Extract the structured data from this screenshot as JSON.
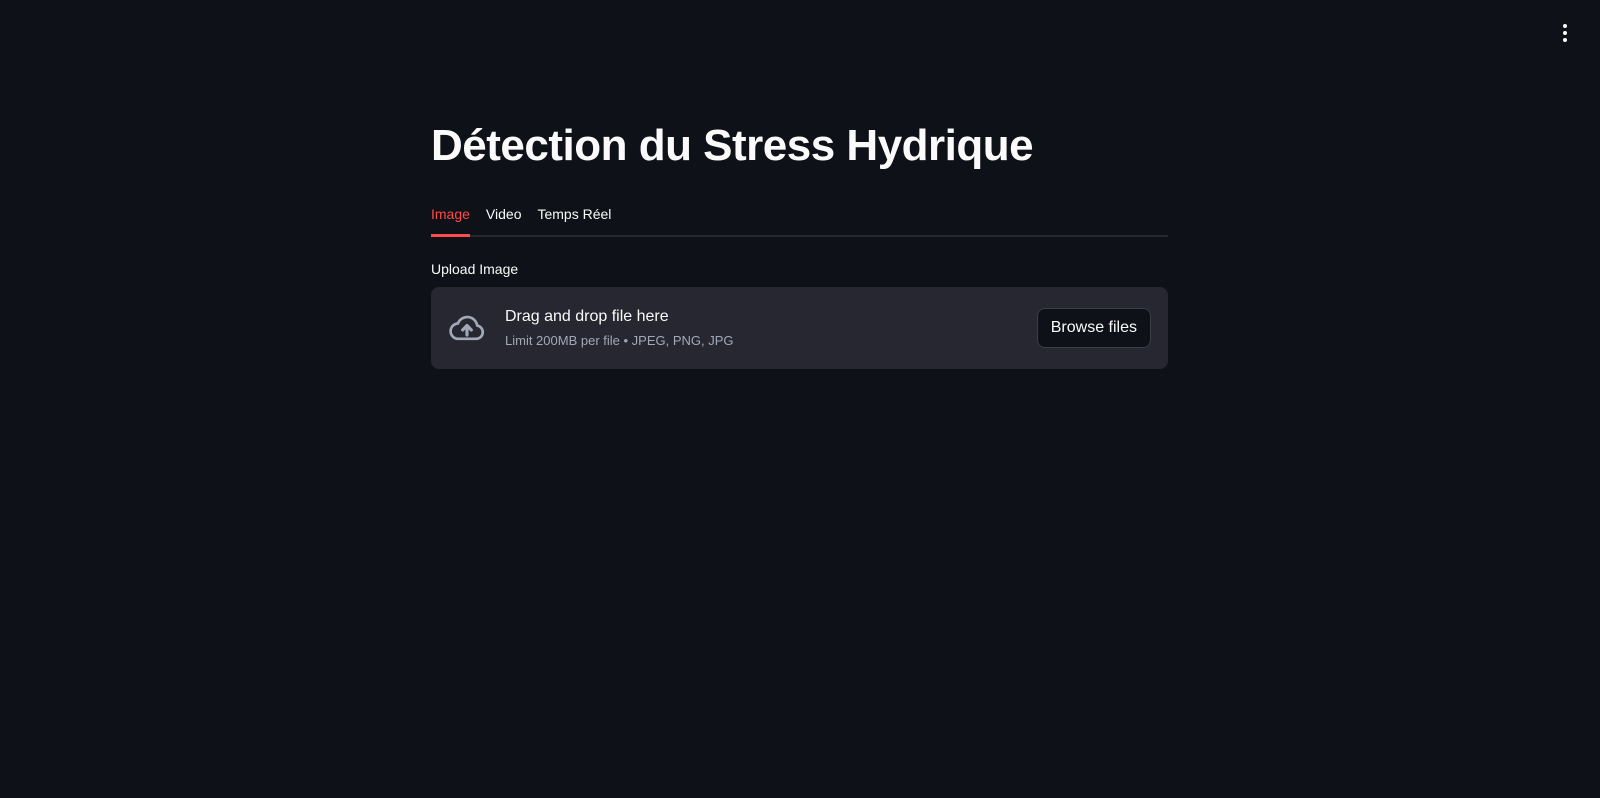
{
  "header": {
    "menu_icon": "kebab-vertical-icon"
  },
  "main": {
    "title": "Détection du Stress Hydrique",
    "tabs": [
      {
        "label": "Image",
        "active": true
      },
      {
        "label": "Video",
        "active": false
      },
      {
        "label": "Temps Réel",
        "active": false
      }
    ],
    "uploader": {
      "label": "Upload Image",
      "icon": "cloud-upload-icon",
      "drop_text": "Drag and drop file here",
      "limit_text": "Limit 200MB per file • JPEG, PNG, JPG",
      "browse_label": "Browse files"
    }
  },
  "colors": {
    "background": "#0e1117",
    "accent": "#ff4b4b",
    "dropzone": "#262730",
    "text": "#fafafa",
    "muted_text": "#a3a8b8"
  }
}
